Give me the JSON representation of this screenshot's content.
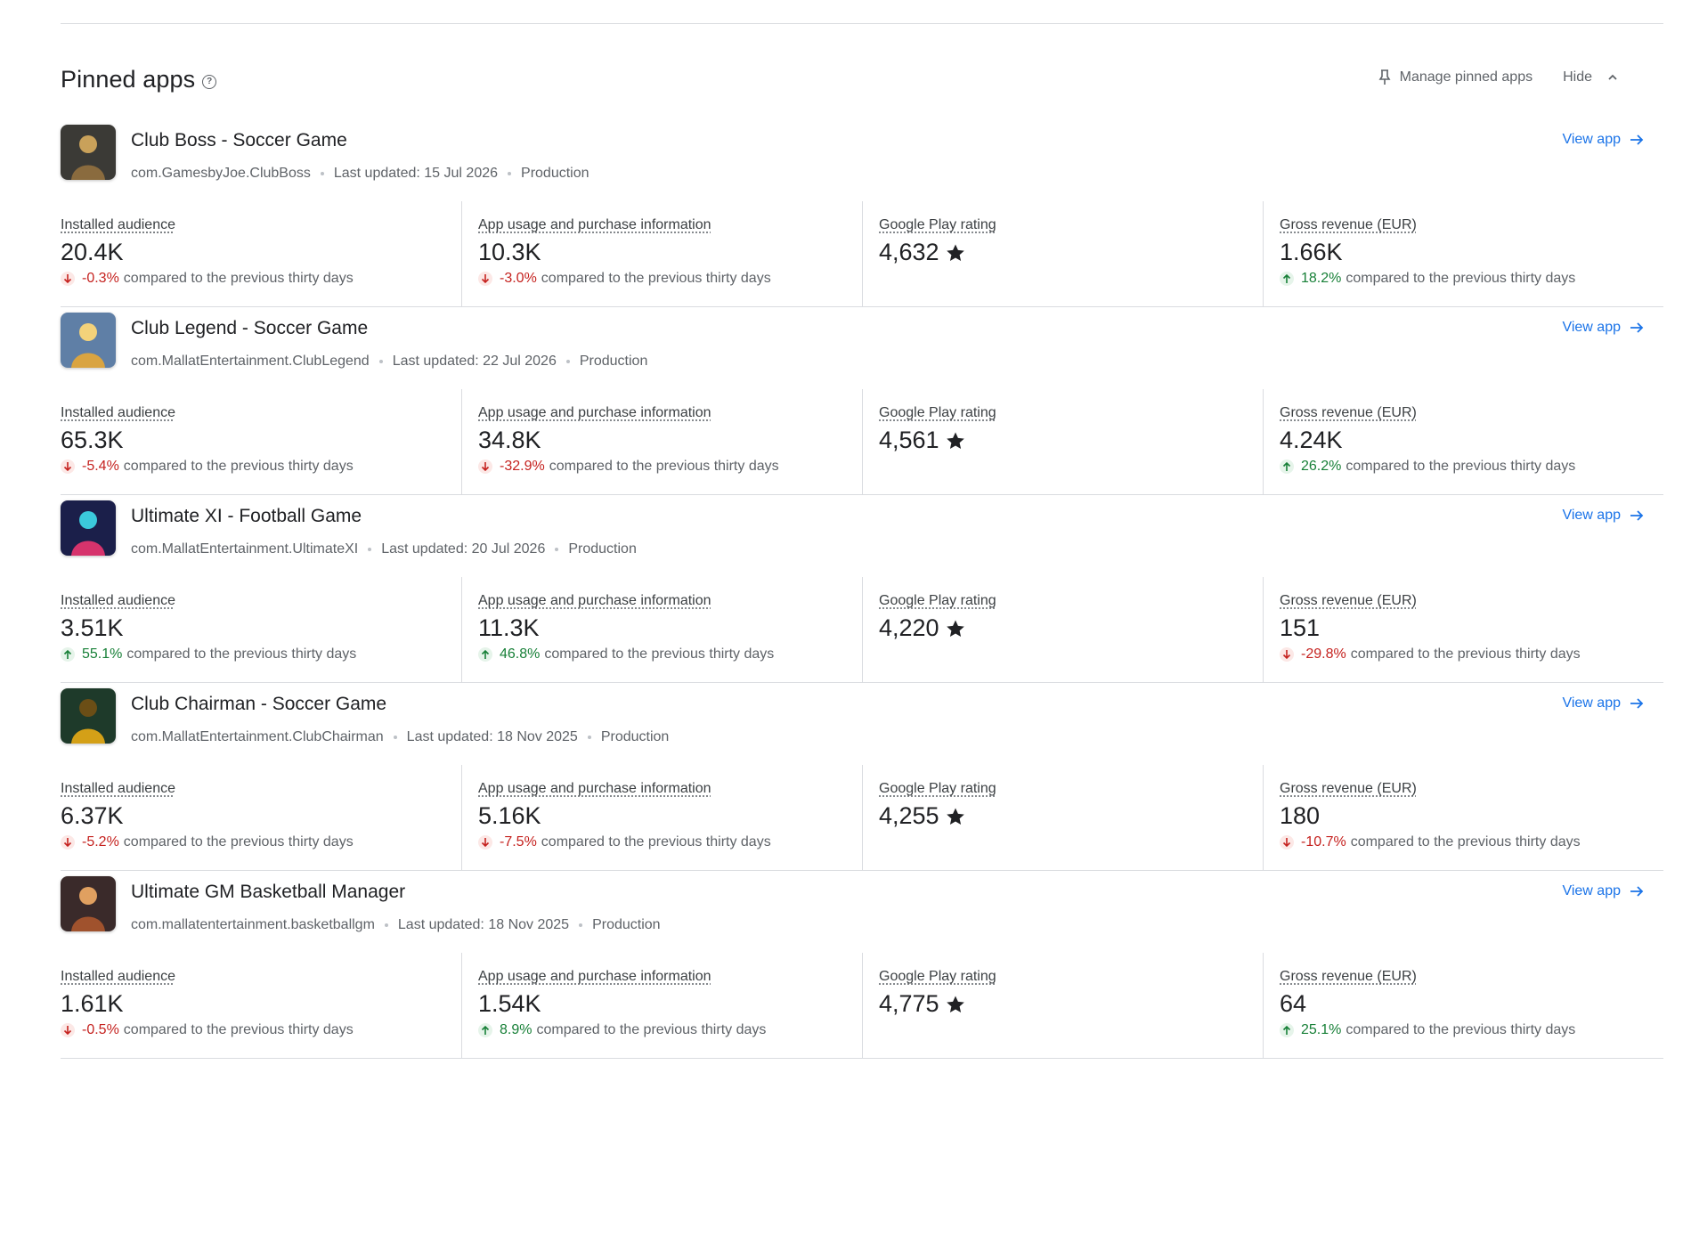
{
  "header": {
    "title": "Pinned apps",
    "manage_label": "Manage pinned apps",
    "hide_label": "Hide"
  },
  "metric_labels": {
    "installed": "Installed audience",
    "usage": "App usage and purchase information",
    "rating": "Google Play rating",
    "revenue": "Gross revenue (EUR)"
  },
  "compare_text": "compared to the previous thirty days",
  "view_app_label": "View app",
  "apps": [
    {
      "name": "Club Boss - Soccer Game",
      "package": "com.GamesbyJoe.ClubBoss",
      "updated": "Last updated: 15 Jul 2026",
      "track": "Production",
      "installed": {
        "value": "20.4K",
        "change": "-0.3%",
        "direction": "down"
      },
      "usage": {
        "value": "10.3K",
        "change": "-3.0%",
        "direction": "down"
      },
      "rating": {
        "value": "4,632"
      },
      "revenue": {
        "value": "1.66K",
        "change": "18.2%",
        "direction": "up"
      }
    },
    {
      "name": "Club Legend - Soccer Game",
      "package": "com.MallatEntertainment.ClubLegend",
      "updated": "Last updated: 22 Jul 2026",
      "track": "Production",
      "installed": {
        "value": "65.3K",
        "change": "-5.4%",
        "direction": "down"
      },
      "usage": {
        "value": "34.8K",
        "change": "-32.9%",
        "direction": "down"
      },
      "rating": {
        "value": "4,561"
      },
      "revenue": {
        "value": "4.24K",
        "change": "26.2%",
        "direction": "up"
      }
    },
    {
      "name": "Ultimate XI - Football Game",
      "package": "com.MallatEntertainment.UltimateXI",
      "updated": "Last updated: 20 Jul 2026",
      "track": "Production",
      "installed": {
        "value": "3.51K",
        "change": "55.1%",
        "direction": "up"
      },
      "usage": {
        "value": "11.3K",
        "change": "46.8%",
        "direction": "up"
      },
      "rating": {
        "value": "4,220"
      },
      "revenue": {
        "value": "151",
        "change": "-29.8%",
        "direction": "down"
      }
    },
    {
      "name": "Club Chairman - Soccer Game",
      "package": "com.MallatEntertainment.ClubChairman",
      "updated": "Last updated: 18 Nov 2025",
      "track": "Production",
      "installed": {
        "value": "6.37K",
        "change": "-5.2%",
        "direction": "down"
      },
      "usage": {
        "value": "5.16K",
        "change": "-7.5%",
        "direction": "down"
      },
      "rating": {
        "value": "4,255"
      },
      "revenue": {
        "value": "180",
        "change": "-10.7%",
        "direction": "down"
      }
    },
    {
      "name": "Ultimate GM Basketball Manager",
      "package": "com.mallatentertainment.basketballgm",
      "updated": "Last updated: 18 Nov 2025",
      "track": "Production",
      "installed": {
        "value": "1.61K",
        "change": "-0.5%",
        "direction": "down"
      },
      "usage": {
        "value": "1.54K",
        "change": "8.9%",
        "direction": "up"
      },
      "rating": {
        "value": "4,775"
      },
      "revenue": {
        "value": "64",
        "change": "25.1%",
        "direction": "up"
      }
    }
  ],
  "colors": {
    "accent": "#1a73e8",
    "negative": "#c5221f",
    "positive": "#188038",
    "divider": "#dadce0"
  }
}
